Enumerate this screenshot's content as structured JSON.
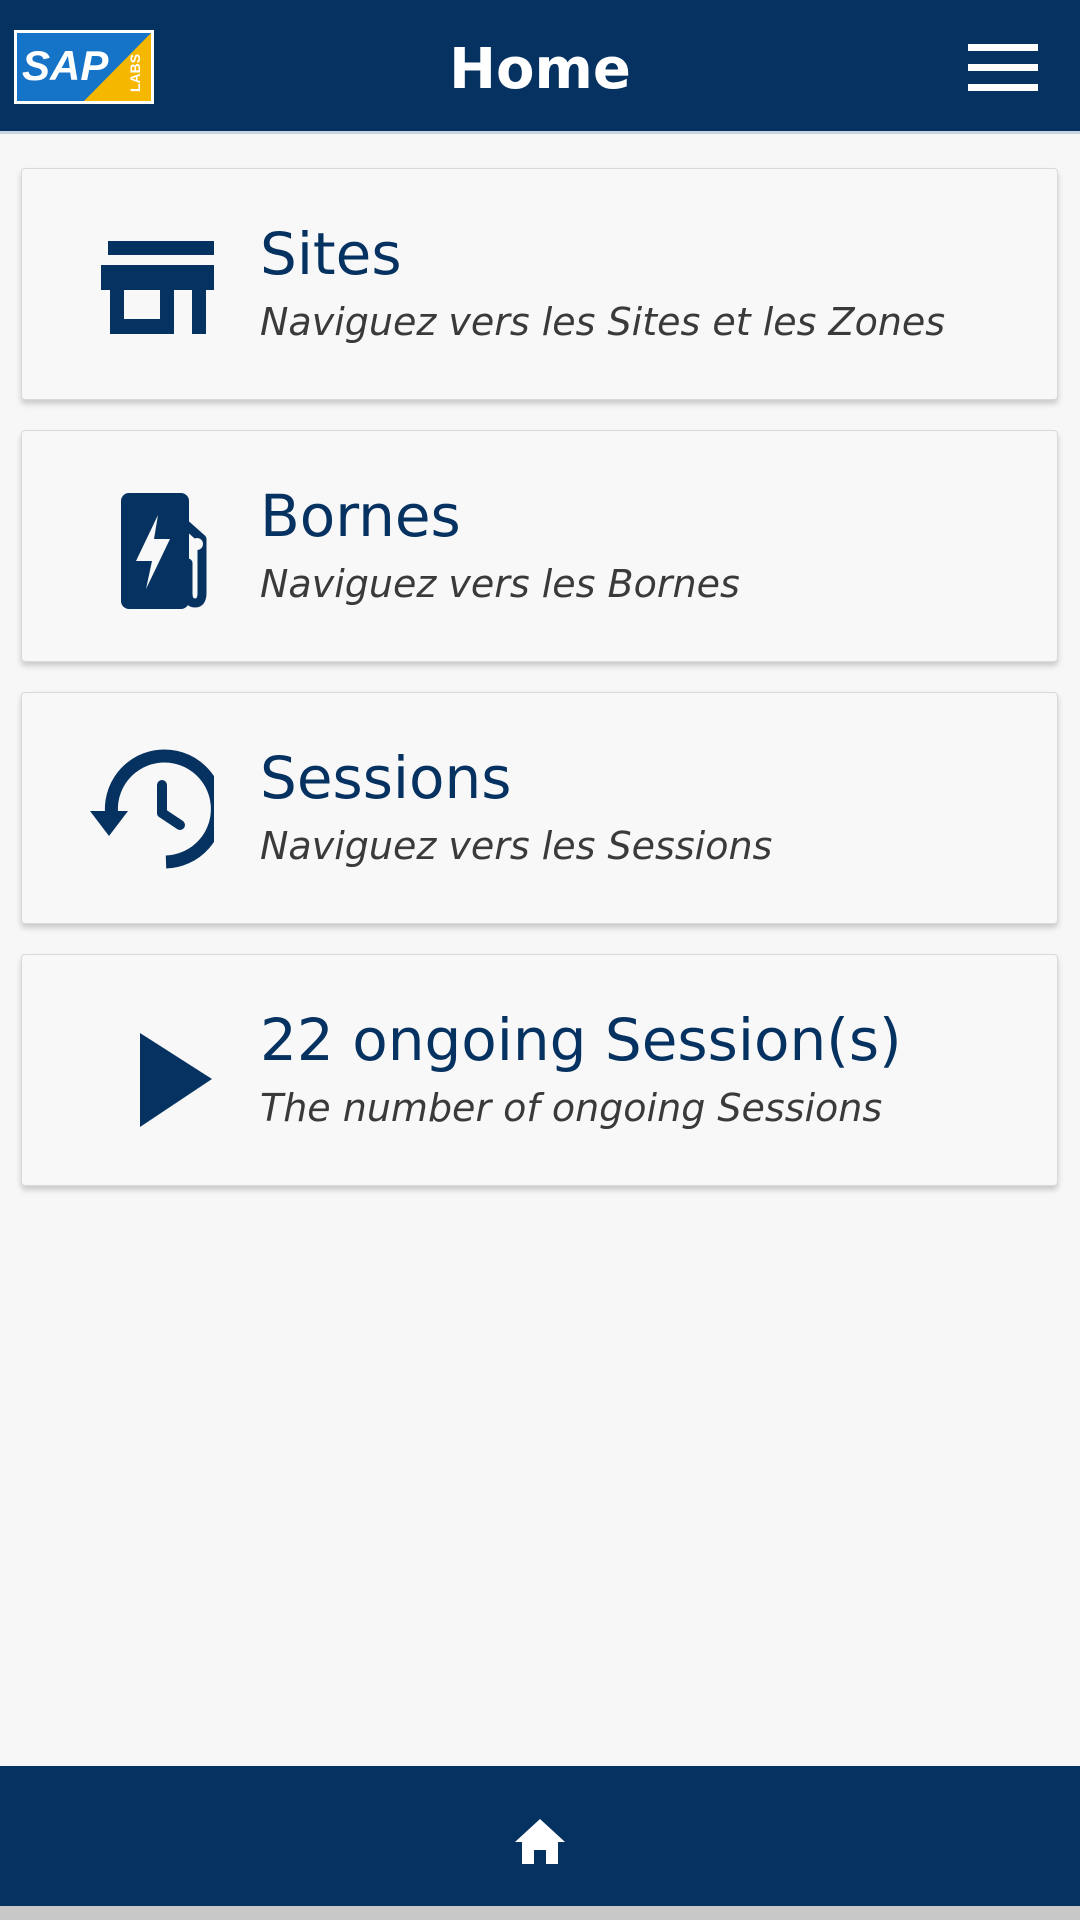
{
  "header": {
    "title": "Home",
    "logo": {
      "brand_text": "SAP",
      "sub_text": "LABS",
      "colors": {
        "blue": "#1574c8",
        "yellow": "#f5b700",
        "border": "#ffffff"
      }
    },
    "menu_icon": "hamburger-menu-icon"
  },
  "cards": [
    {
      "icon": "storefront-icon",
      "title": "Sites",
      "subtitle": "Naviguez vers les Sites et les Zones"
    },
    {
      "icon": "ev-charging-station-icon",
      "title": "Bornes",
      "subtitle": "Naviguez vers les Bornes"
    },
    {
      "icon": "history-clock-icon",
      "title": "Sessions",
      "subtitle": "Naviguez vers les Sessions"
    },
    {
      "icon": "play-icon",
      "title": "22 ongoing Session(s)",
      "subtitle": "The number of ongoing Sessions"
    }
  ],
  "footer": {
    "home_icon": "home-icon"
  },
  "colors": {
    "primary": "#063261",
    "background": "#f7f7f8",
    "card_background": "#f8f8f8",
    "subtitle_text": "#3a3a3a",
    "header_text": "#ffffff"
  }
}
